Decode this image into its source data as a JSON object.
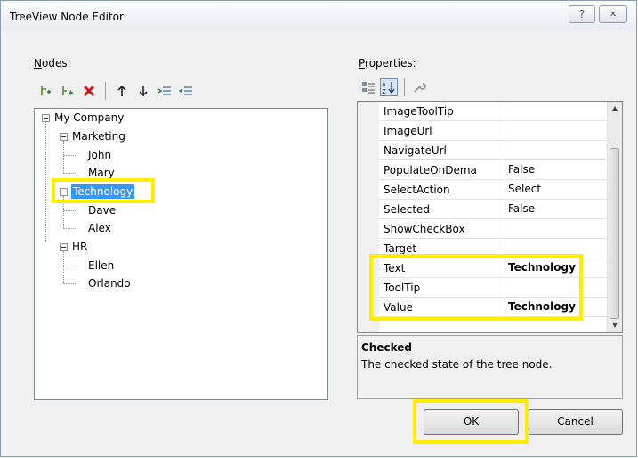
{
  "window": {
    "title": "TreeView Node Editor",
    "help_glyph": "?",
    "close_glyph": "✕"
  },
  "nodes": {
    "label_accel": "N",
    "label_rest": "odes:",
    "toolbar": [
      {
        "name": "add-root-icon"
      },
      {
        "name": "add-child-icon"
      },
      {
        "name": "delete-icon"
      },
      {
        "name": "move-up-icon"
      },
      {
        "name": "move-down-icon"
      },
      {
        "name": "indent-icon"
      },
      {
        "name": "unindent-icon"
      }
    ],
    "tree": {
      "root": "My Company",
      "marketing": "Marketing",
      "john": "John",
      "mary": "Mary",
      "technology": "Technology",
      "dave": "Dave",
      "alex": "Alex",
      "hr": "HR",
      "ellen": "Ellen",
      "orlando": "Orlando"
    }
  },
  "properties": {
    "label_accel": "P",
    "label_rest": "roperties:",
    "rows": [
      {
        "name": "ImageToolTip",
        "value": ""
      },
      {
        "name": "ImageUrl",
        "value": ""
      },
      {
        "name": "NavigateUrl",
        "value": ""
      },
      {
        "name": "PopulateOnDema",
        "value": "False"
      },
      {
        "name": "SelectAction",
        "value": "Select"
      },
      {
        "name": "Selected",
        "value": "False"
      },
      {
        "name": "ShowCheckBox",
        "value": ""
      },
      {
        "name": "Target",
        "value": ""
      },
      {
        "name": "Text",
        "value": "Technology"
      },
      {
        "name": "ToolTip",
        "value": ""
      },
      {
        "name": "Value",
        "value": "Technology"
      }
    ],
    "help_title": "Checked",
    "help_text": "The checked state of the tree node."
  },
  "buttons": {
    "ok": "OK",
    "cancel": "Cancel"
  },
  "colors": {
    "highlight": "#ffee00",
    "selection": "#3399ff"
  }
}
